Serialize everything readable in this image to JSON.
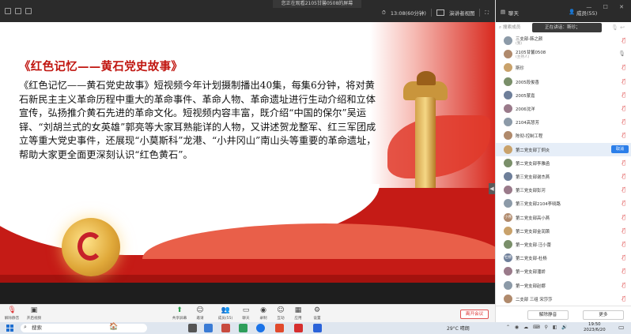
{
  "window": {
    "banner": "您正在观看2105甘馨0508的屏幕",
    "time_label": "13:08(60分钟)",
    "view_label": "演讲者视图"
  },
  "panel_tabs": {
    "chat": "聊天",
    "members": "成员(55)"
  },
  "slide": {
    "title": "《红色记忆——黄石党史故事》",
    "body": "《红色记忆——黄石党史故事》短视频今年计划摄制播出40集，每集6分钟，将对黄石新民主主义革命历程中重大的革命事件、革命人物、革命遗址进行生动介绍和立体宣传，弘扬推介黄石先进的革命文化。短视频内容丰富，既介绍“中国的保尔”吴运铎、“刘胡兰式的女英雄”郭亮等大家耳熟能详的人物，又讲述贺龙整军、红三军团成立等重大党史事件，还展现“小莫斯科”龙港、“小井冈山”南山头等重要的革命遗址，帮助大家更全面更深刻认识“红色黄石”。"
  },
  "toolbar": {
    "items": [
      {
        "label": "解除静音",
        "icon": "microphone-icon"
      },
      {
        "label": "开启视频",
        "icon": "camera-icon"
      },
      {
        "label": "共享屏幕",
        "icon": "share-screen-icon"
      },
      {
        "label": "邀请",
        "icon": "invite-icon"
      },
      {
        "label": "成员(55)",
        "icon": "members-icon"
      },
      {
        "label": "聊天",
        "icon": "chat-icon"
      },
      {
        "label": "录制",
        "icon": "record-icon"
      },
      {
        "label": "互动",
        "icon": "interact-icon"
      },
      {
        "label": "应用",
        "icon": "apps-icon"
      },
      {
        "label": "设置",
        "icon": "settings-icon"
      }
    ],
    "leave": "离开会议"
  },
  "members_panel": {
    "search_placeholder": "搜索成员",
    "speaking": "正在讲话：斯珍；",
    "members": [
      {
        "name": "三支部-韩之颜",
        "sub": "(我)",
        "avatar": "",
        "mic": "muted"
      },
      {
        "name": "2105甘馨0508",
        "sub": "(主持人)",
        "avatar": "",
        "mic": "on"
      },
      {
        "name": "斯珍",
        "sub": "",
        "avatar": "",
        "mic": "muted"
      },
      {
        "name": "2005段俊香",
        "sub": "",
        "avatar": "",
        "mic": "muted"
      },
      {
        "name": "2005蒙嘉",
        "sub": "",
        "avatar": "",
        "mic": "muted"
      },
      {
        "name": "2006沈洋",
        "sub": "",
        "avatar": "",
        "mic": "muted"
      },
      {
        "name": "2104高慧芳",
        "sub": "",
        "avatar": "",
        "mic": "muted"
      },
      {
        "name": "陈彻-控制工程",
        "sub": "",
        "avatar": "",
        "mic": "muted"
      },
      {
        "name": "第二党支部丁炯炎",
        "sub": "",
        "avatar": "",
        "mic": "muted",
        "highlight": true
      },
      {
        "name": "第二党支部李雅函",
        "sub": "",
        "avatar": "",
        "mic": "muted"
      },
      {
        "name": "第三党支部谢杰燕",
        "sub": "",
        "avatar": "",
        "mic": "muted"
      },
      {
        "name": "第三党支部彭河",
        "sub": "",
        "avatar": "",
        "mic": "muted"
      },
      {
        "name": "第三党支部2104李晓路",
        "sub": "",
        "avatar": "",
        "mic": "muted"
      },
      {
        "name": "第二党支部高小燕",
        "sub": "",
        "avatar": "小燕",
        "mic": "muted"
      },
      {
        "name": "第二党支部金润萧",
        "sub": "",
        "avatar": "",
        "mic": "muted"
      },
      {
        "name": "第一党支部·汪小蕾",
        "sub": "",
        "avatar": "",
        "mic": "muted"
      },
      {
        "name": "第二党支部-杜杨",
        "sub": "",
        "avatar": "杜杨",
        "mic": "muted"
      },
      {
        "name": "第一党支部潘娇",
        "sub": "",
        "avatar": "",
        "mic": "muted"
      },
      {
        "name": "第一党支部赵娜",
        "sub": "",
        "avatar": "",
        "mic": "muted"
      },
      {
        "name": "二支部 三组 宋莎莎",
        "sub": "",
        "avatar": "",
        "mic": "muted"
      }
    ],
    "unmute_button": "取消",
    "footer_unmute_all": "解除静音",
    "footer_more": "更多"
  },
  "taskbar": {
    "search": "搜索",
    "weather": "29°C 晴朗",
    "time": "19:50",
    "date": "2023/6/20"
  }
}
